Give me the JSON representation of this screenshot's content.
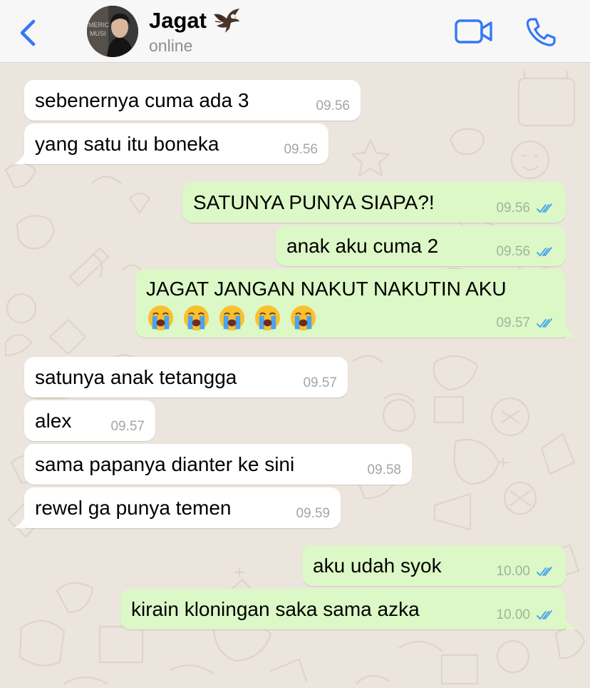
{
  "header": {
    "contact_name": "Jagat",
    "status": "online",
    "avatar_icon": "profile-photo",
    "name_emoji_icon": "eagle-icon",
    "back_icon": "chevron-left-icon",
    "video_icon": "video-camera-icon",
    "call_icon": "phone-icon",
    "accent_color": "#3478f6"
  },
  "colors": {
    "incoming_bubble": "#ffffff",
    "outgoing_bubble": "#dcf8c6",
    "chat_background": "#ece5dd",
    "read_ticks": "#4fa8e8"
  },
  "messages": [
    {
      "direction": "incoming",
      "text": "sebenernya cuma ada 3",
      "time": "09.56"
    },
    {
      "direction": "incoming",
      "text": "yang satu itu boneka",
      "time": "09.56"
    },
    {
      "direction": "outgoing",
      "text": "SATUNYA PUNYA SIAPA?!",
      "time": "09.56",
      "status": "read"
    },
    {
      "direction": "outgoing",
      "text": "anak aku cuma 2",
      "time": "09.56",
      "status": "read"
    },
    {
      "direction": "outgoing",
      "text": "JAGAT JANGAN NAKUT NAKUTIN AKU",
      "time": "09.57",
      "status": "read",
      "emojis": [
        "loudly-crying-face",
        "loudly-crying-face",
        "loudly-crying-face",
        "loudly-crying-face",
        "loudly-crying-face"
      ]
    },
    {
      "direction": "incoming",
      "text": "satunya anak tetangga",
      "time": "09.57"
    },
    {
      "direction": "incoming",
      "text": "alex",
      "time": "09.57"
    },
    {
      "direction": "incoming",
      "text": "sama papanya dianter ke sini",
      "time": "09.58"
    },
    {
      "direction": "incoming",
      "text": "rewel ga punya temen",
      "time": "09.59"
    },
    {
      "direction": "outgoing",
      "text": "aku udah syok",
      "time": "10.00",
      "status": "read"
    },
    {
      "direction": "outgoing",
      "text": "kirain kloningan saka sama azka",
      "time": "10.00",
      "status": "read"
    }
  ]
}
